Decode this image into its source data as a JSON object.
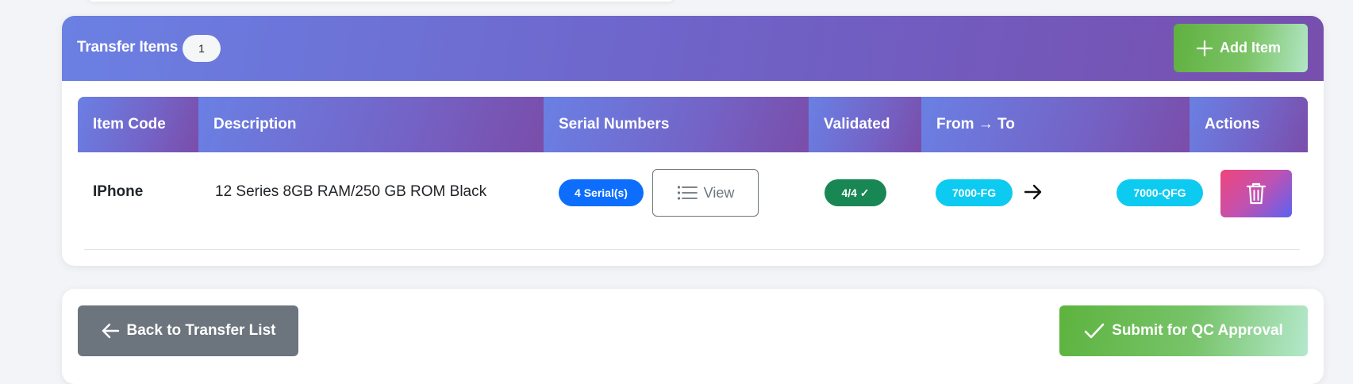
{
  "transfer_items": {
    "title": "Transfer Items",
    "count": "1",
    "add_button_label": "Add Item",
    "columns": [
      "Item Code",
      "Description",
      "Serial Numbers",
      "Validated",
      "From → To",
      "Actions"
    ],
    "rows": [
      {
        "item_code": "IPhone",
        "description": "12 Series 8GB RAM/250 GB ROM Black",
        "serial_badge": "4 Serial(s)",
        "view_label": "View",
        "validated": "4/4 ✓",
        "from": "7000-FG",
        "to": "7000-QFG"
      }
    ]
  },
  "footer": {
    "back_label": "Back to Transfer List",
    "submit_label": "Submit for QC Approval"
  },
  "icons": {
    "add": "plus-icon",
    "view": "list-icon",
    "transfer": "arrow-right-icon",
    "delete": "trash-icon",
    "back": "arrow-left-icon",
    "submit": "check-icon"
  },
  "colors": {
    "header_gradient_start": "#6b80e3",
    "header_gradient_end": "#774fae",
    "serial_badge": "#0d6efd",
    "validated_badge": "#198754",
    "location_badge": "#0dcaf0",
    "back_button": "#6c757d",
    "success_gradient": "#5fb040"
  }
}
